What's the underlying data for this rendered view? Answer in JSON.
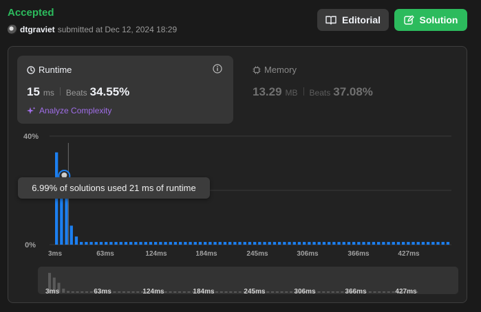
{
  "header": {
    "status": "Accepted",
    "username": "dtgraviet",
    "submitted_text": "submitted at Dec 12, 2024 18:29"
  },
  "buttons": {
    "editorial": "Editorial",
    "solution": "Solution"
  },
  "runtime": {
    "title": "Runtime",
    "value": "15",
    "unit": "ms",
    "beats_label": "Beats",
    "beats": "34.55%",
    "analyze": "Analyze Complexity"
  },
  "memory": {
    "title": "Memory",
    "value": "13.29",
    "unit": "MB",
    "beats_label": "Beats",
    "beats": "37.08%"
  },
  "tooltip": "6.99% of solutions used 21 ms of runtime",
  "colors": {
    "accepted": "#2cbb5d",
    "bar": "#1c7ff0",
    "purple": "#a06ee8",
    "mini_bar": "#5a5a5a"
  },
  "chart_data": {
    "type": "bar",
    "ylim": [
      0,
      40
    ],
    "ytick_labels": [
      "40%",
      "0%"
    ],
    "xtick_labels": [
      "3ms",
      "63ms",
      "124ms",
      "184ms",
      "245ms",
      "306ms",
      "366ms",
      "427ms"
    ],
    "values": [
      34,
      26,
      17,
      7,
      3,
      1,
      1,
      1,
      1,
      1,
      1,
      1,
      1,
      1,
      1,
      1,
      1,
      1,
      1,
      1,
      1,
      1,
      1,
      1,
      1,
      1,
      1,
      1,
      1,
      1,
      1,
      1,
      1,
      1,
      1,
      1,
      1,
      1,
      1,
      1,
      1,
      1,
      1,
      1,
      1,
      1,
      1,
      1,
      1,
      1,
      1,
      1,
      1,
      1,
      1,
      1,
      1,
      1,
      1,
      1,
      1,
      1,
      1,
      1,
      1,
      1,
      1,
      1,
      1,
      1,
      1,
      1,
      1,
      1,
      1,
      1,
      1,
      1,
      1,
      1
    ],
    "highlight_ms": 21,
    "highlight_percent": 6.99,
    "mini_xtick_labels": [
      "3ms",
      "63ms",
      "124ms",
      "184ms",
      "245ms",
      "306ms",
      "366ms",
      "427ms"
    ]
  }
}
